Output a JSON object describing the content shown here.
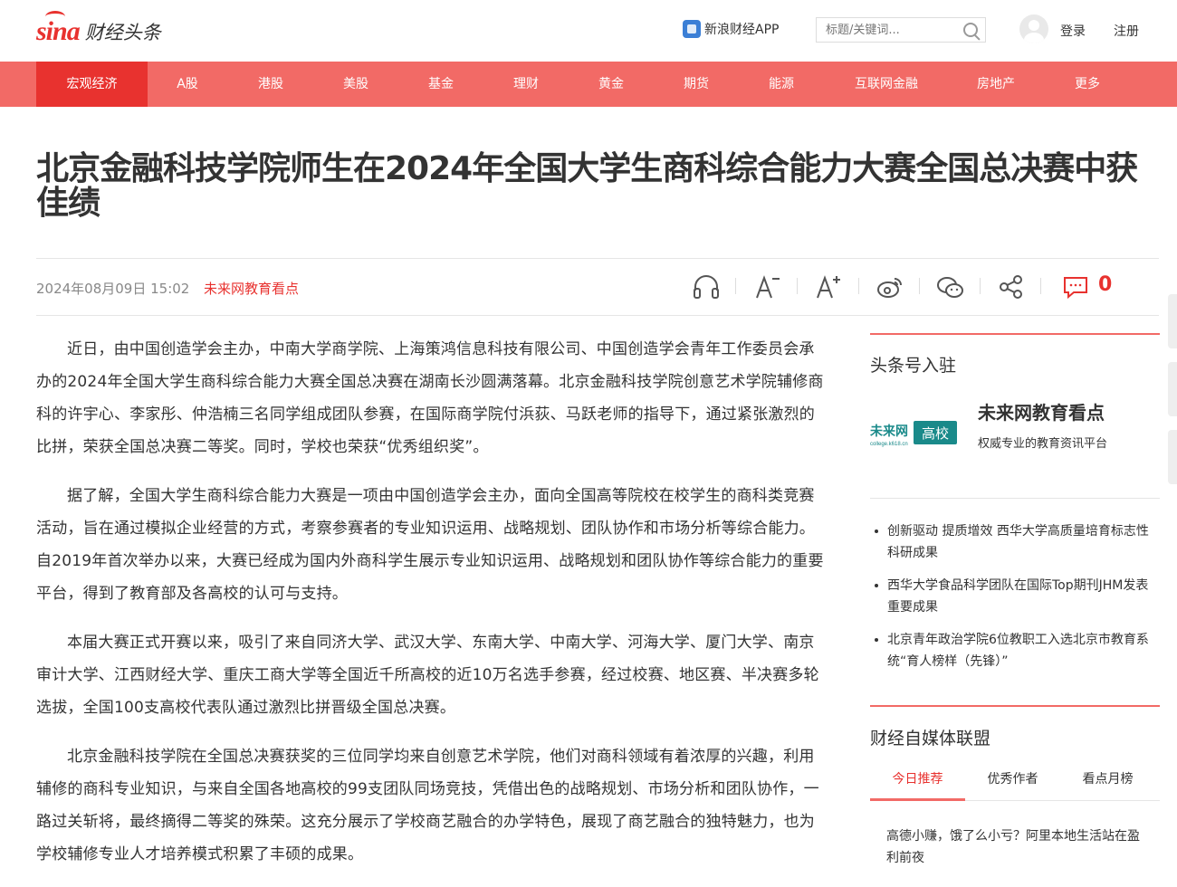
{
  "header": {
    "logo_brand": "sina",
    "logo_site": "财经头条",
    "app_link": "新浪财经APP",
    "search_placeholder": "标题/关键词...",
    "login": "登录",
    "register": "注册"
  },
  "nav": {
    "items": [
      "宏观经济",
      "A股",
      "港股",
      "美股",
      "基金",
      "理财",
      "黄金",
      "期货",
      "能源",
      "互联网金融",
      "房地产",
      "更多"
    ],
    "active": "宏观经济",
    "colors": {
      "bar": "#f26a66",
      "active": "#e8322f"
    }
  },
  "article": {
    "title": "北京金融科技学院师生在2024年全国大学生商科综合能力大赛全国总决赛中获佳绩",
    "date": "2024年08月09日 15:02",
    "source": "未来网教育看点",
    "comment_count": "0",
    "tools": [
      "headphones-icon",
      "font-decrease-icon",
      "font-increase-icon",
      "weibo-icon",
      "wechat-icon",
      "share-icon",
      "comment-icon"
    ],
    "paragraphs": [
      "近日，由中国创造学会主办，中南大学商学院、上海策鸿信息科技有限公司、中国创造学会青年工作委员会承办的2024年全国大学生商科综合能力大赛全国总决赛在湖南长沙圆满落幕。北京金融科技学院创意艺术学院辅修商科的许宇心、李家彤、仲浩楠三名同学组成团队参赛，在国际商学院付浜荻、马跃老师的指导下，通过紧张激烈的比拼，荣获全国总决赛二等奖。同时，学校也荣获“优秀组织奖”。",
      "据了解，全国大学生商科综合能力大赛是一项由中国创造学会主办，面向全国高等院校在校学生的商科类竞赛活动，旨在通过模拟企业经营的方式，考察参赛者的专业知识运用、战略规划、团队协作和市场分析等综合能力。自2019年首次举办以来，大赛已经成为国内外商科学生展示专业知识运用、战略规划和团队协作等综合能力的重要平台，得到了教育部及各高校的认可与支持。",
      "本届大赛正式开赛以来，吸引了来自同济大学、武汉大学、东南大学、中南大学、河海大学、厦门大学、南京审计大学、江西财经大学、重庆工商大学等全国近千所高校的近10万名选手参赛，经过校赛、地区赛、半决赛多轮选拔，全国100支高校代表队通过激烈比拼晋级全国总决赛。",
      "北京金融科技学院在全国总决赛获奖的三位同学均来自创意艺术学院，他们对商科领域有着浓厚的兴趣，利用辅修的商科专业知识，与来自全国各地高校的99支团队同场竞技，凭借出色的战略规划、市场分析和团队协作，一路过关斩将，最终摘得二等奖的殊荣。这充分展示了学校商艺融合的办学特色，展现了商艺融合的独特魅力，也为学校辅修专业人才培养模式积累了丰硕的成果。"
    ]
  },
  "sidebar": {
    "section1_title": "头条号入驻",
    "media": {
      "logo_left": "未来网",
      "logo_left_sub": "college.k618.cn",
      "logo_right": "高校",
      "name": "未来网教育看点",
      "desc": "权威专业的教育资讯平台"
    },
    "news": [
      "创新驱动 提质增效 西华大学高质量培育标志性科研成果",
      "西华大学食品科学团队在国际Top期刊JHM发表重要成果",
      "北京青年政治学院6位教职工入选北京市教育系统“育人榜样（先锋）”"
    ],
    "section2_title": "财经自媒体联盟",
    "tabs": [
      "今日推荐",
      "优秀作者",
      "看点月榜"
    ],
    "feed_first": "高德小赚，饿了么小亏？阿里本地生活站在盈利前夜"
  }
}
